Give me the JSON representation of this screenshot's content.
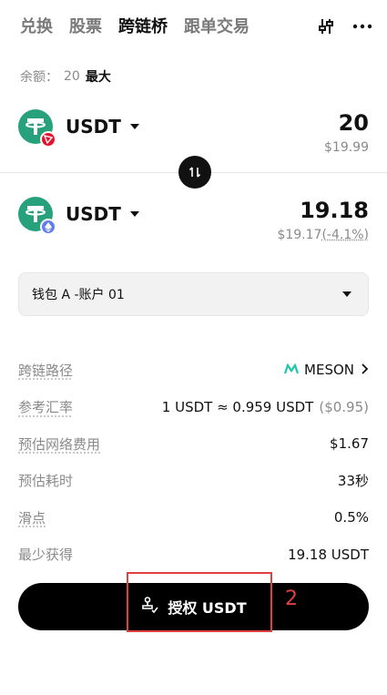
{
  "tabs": [
    {
      "label": "兑换"
    },
    {
      "label": "股票"
    },
    {
      "label": "跨链桥"
    },
    {
      "label": "跟单交易"
    }
  ],
  "active_tab": "跨链桥",
  "balance": {
    "label": "余额：",
    "value": "20",
    "max_label": "最大"
  },
  "from": {
    "symbol": "USDT",
    "amount": "20",
    "usd": "$19.99",
    "chain_icon": "tron-icon"
  },
  "to": {
    "symbol": "USDT",
    "amount": "19.18",
    "usd": "$19.17",
    "change": "(-4.1%)",
    "chain_icon": "ethereum-icon"
  },
  "wallet": {
    "label": "钱包 A -账户 01"
  },
  "info": {
    "route_label": "跨链路径",
    "route_value": "MESON",
    "rate_label": "参考汇率",
    "rate_value": "1 USDT ≈ 0.959 USDT",
    "rate_usd": "($0.95)",
    "fee_label": "预估网络费用",
    "fee_value": "$1.67",
    "time_label": "预估耗时",
    "time_value": "33秒",
    "slippage_label": "滑点",
    "slippage_value": "0.5%",
    "min_label": "最少获得",
    "min_value": "19.18 USDT"
  },
  "approve_label": "授权 USDT",
  "annotation_number": "2",
  "colors": {
    "tether": "#26a17b",
    "tron": "#e8112d",
    "ethereum": "#627eea",
    "annotation": "#e04040",
    "meson": "#1fc6a8"
  }
}
